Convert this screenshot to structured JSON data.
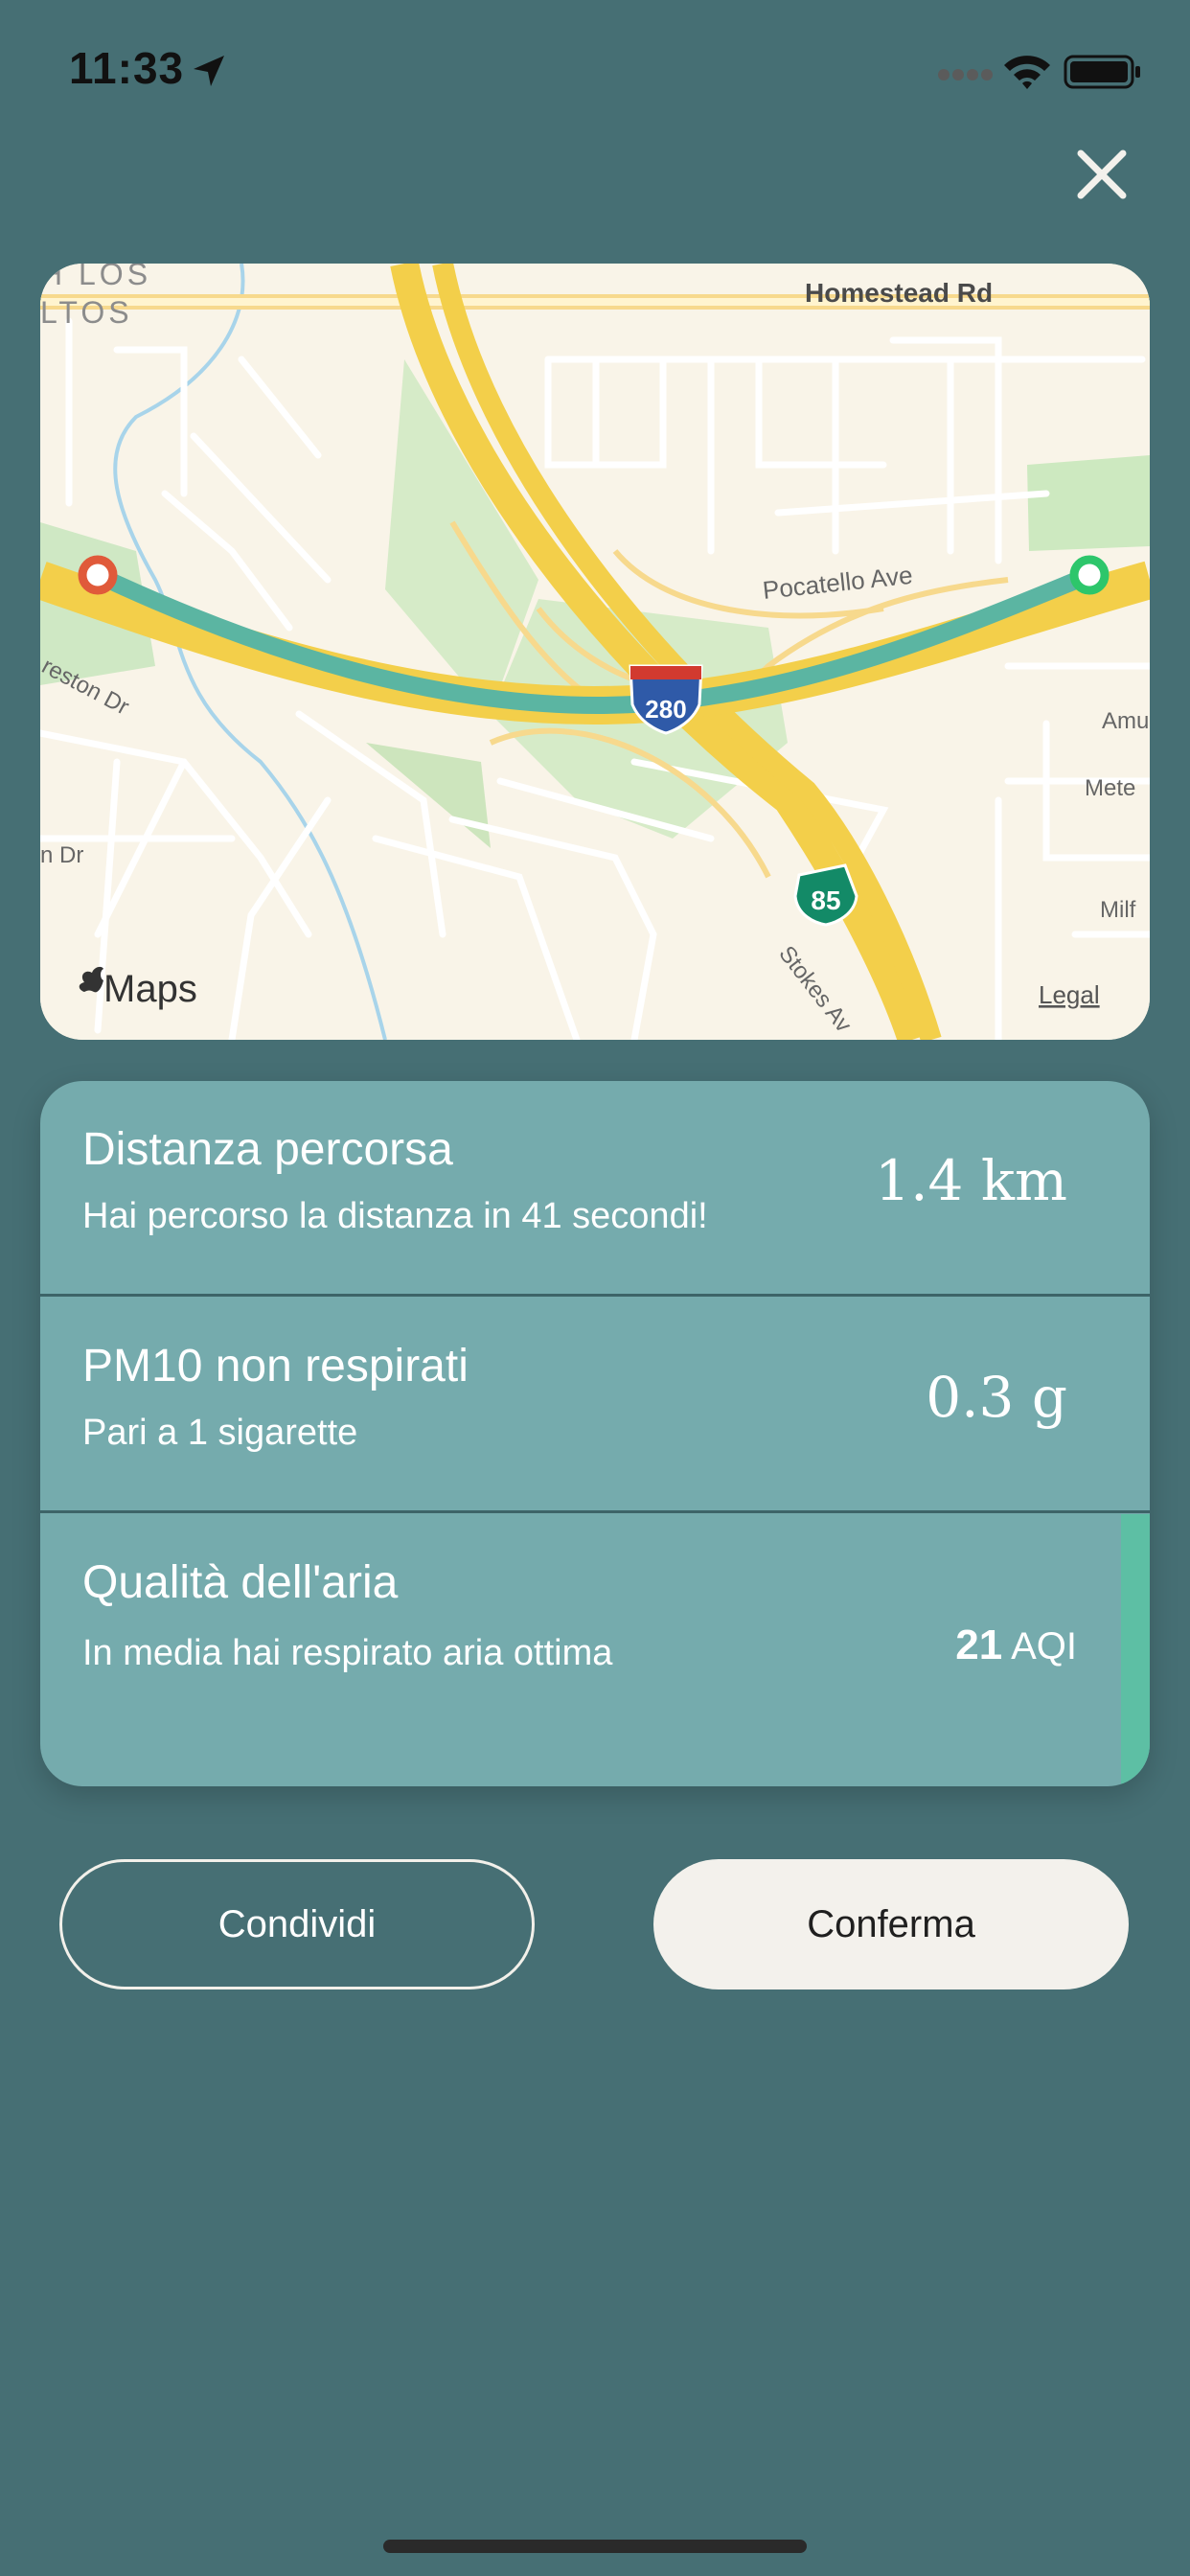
{
  "status_bar": {
    "time": "11:33"
  },
  "map": {
    "labels": {
      "homestead": "Homestead Rd",
      "pocatello": "Pocatello Ave",
      "los_altos_1": "H LOS",
      "los_altos_2": "LTOS",
      "preston": "reston Dr",
      "dr": "n Dr",
      "amu": "Amu",
      "meteo": "Mete",
      "milf": "Milf",
      "stokes": "Stokes Av",
      "shield_280": "280",
      "shield_85": "85",
      "maps_brand": "Maps",
      "legal": "Legal"
    },
    "colors": {
      "route": "#5bb5a2",
      "start": "#e05a3a",
      "end": "#2dc66b"
    }
  },
  "stats": [
    {
      "title": "Distanza percorsa",
      "subtitle": "Hai percorso la distanza in 41 secondi!",
      "value": "1.4 km"
    },
    {
      "title": "PM10 non respirati",
      "subtitle": "Pari a 1 sigarette",
      "value": "0.3 g"
    },
    {
      "title": "Qualità dell'aria",
      "subtitle": "In media hai respirato aria ottima",
      "value_number": "21",
      "value_unit": "AQI"
    }
  ],
  "buttons": {
    "share": "Condividi",
    "confirm": "Conferma"
  }
}
